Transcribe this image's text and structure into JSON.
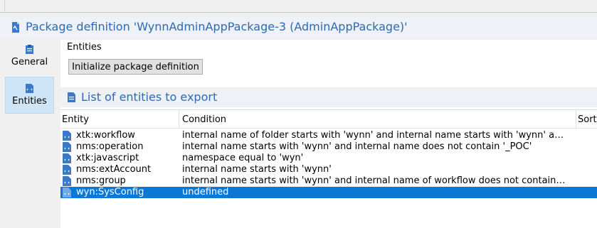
{
  "header": {
    "title": "Package definition 'WynnAdminAppPackage-3 (AdminAppPackage)'",
    "icon": "package-icon"
  },
  "sidebar": {
    "items": [
      {
        "label": "General",
        "icon": "general-icon"
      },
      {
        "label": "Entities",
        "icon": "entities-icon"
      }
    ]
  },
  "entities_section": {
    "label": "Entities",
    "button_label": "Initialize package definition"
  },
  "list": {
    "title": "List of entities to export",
    "columns": [
      "Entity",
      "Condition",
      "Sort"
    ],
    "rows": [
      {
        "entity": "xtk:workflow",
        "condition": "internal name of folder starts with 'wynn' and internal name starts with 'wynn' and int..."
      },
      {
        "entity": "nms:operation",
        "condition": "internal name starts with 'wynn' and internal name does not contain '_POC'"
      },
      {
        "entity": "xtk:javascript",
        "condition": "namespace equal to 'wyn'"
      },
      {
        "entity": "nms:extAccount",
        "condition": "internal name starts with 'wynn'"
      },
      {
        "entity": "nms:group",
        "condition": "internal name starts with 'wynn' and internal name of workflow does not contain '_POC'"
      },
      {
        "entity": "wyn:SysConfig",
        "condition": "undefined"
      }
    ],
    "selected_index": 5
  },
  "colors": {
    "accent": "#2d6ab4",
    "selection": "#0a78d7",
    "tab_active": "#cde5f7"
  }
}
